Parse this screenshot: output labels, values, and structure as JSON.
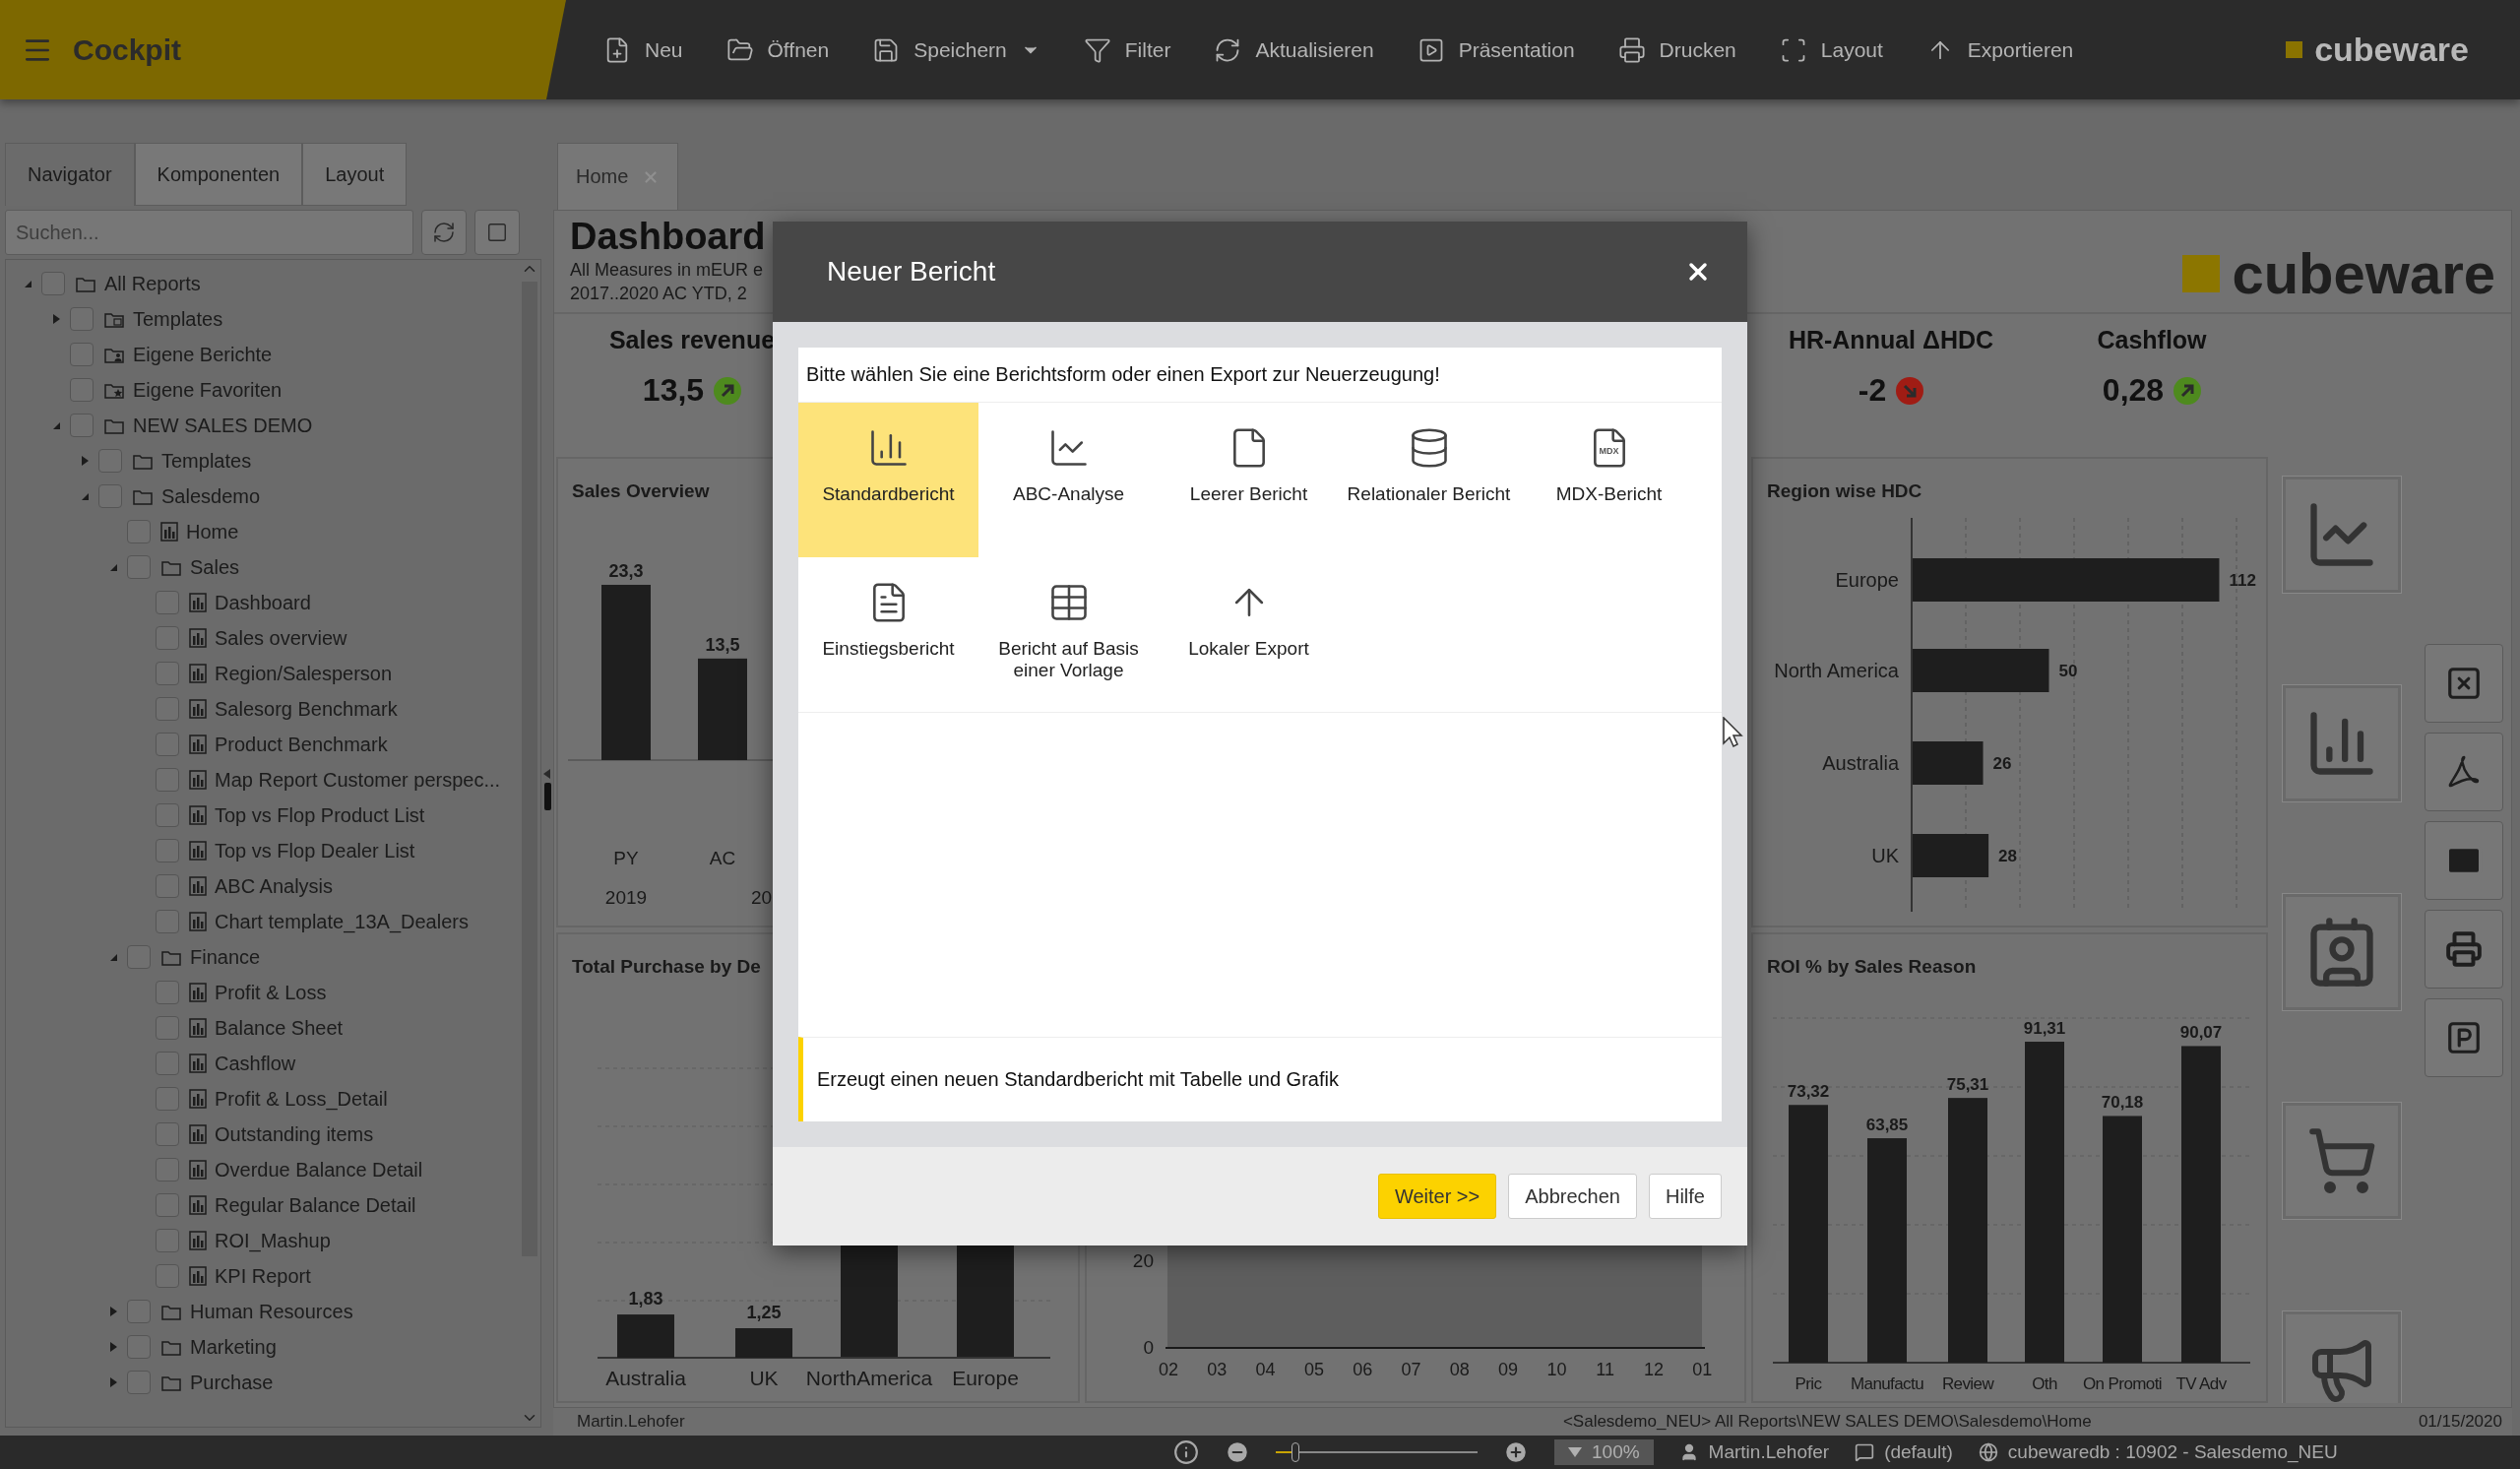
{
  "app": {
    "title": "Cockpit",
    "brand": "cubeware"
  },
  "toolbar": [
    {
      "label": "Neu"
    },
    {
      "label": "Öffnen"
    },
    {
      "label": "Speichern",
      "dropdown": true
    },
    {
      "label": "Filter"
    },
    {
      "label": "Aktualisieren"
    },
    {
      "label": "Präsentation"
    },
    {
      "label": "Drucken"
    },
    {
      "label": "Layout"
    },
    {
      "label": "Exportieren"
    }
  ],
  "sidebar": {
    "tabs": [
      {
        "label": "Navigator",
        "selected": true
      },
      {
        "label": "Komponenten",
        "selected": false
      },
      {
        "label": "Layout",
        "selected": false
      }
    ],
    "search": {
      "placeholder": "Suchen..."
    },
    "tree": [
      {
        "label": "All Reports",
        "kind": "folder",
        "checked": false,
        "expanded": true,
        "children": [
          {
            "label": "Templates",
            "kind": "template-folder",
            "checked": false,
            "expanded": false
          },
          {
            "label": "Eigene Berichte",
            "kind": "user-folder",
            "checked": false
          },
          {
            "label": "Eigene Favoriten",
            "kind": "favorites-folder",
            "checked": false
          },
          {
            "label": "NEW SALES DEMO",
            "kind": "folder",
            "checked": false,
            "expanded": true,
            "children": [
              {
                "label": "Templates",
                "kind": "folder",
                "checked": false,
                "expanded": false
              },
              {
                "label": "Salesdemo",
                "kind": "folder",
                "checked": false,
                "expanded": true,
                "children": [
                  {
                    "label": "Home",
                    "kind": "report",
                    "checked": false
                  },
                  {
                    "label": "Sales",
                    "kind": "folder",
                    "checked": false,
                    "expanded": true,
                    "children": [
                      {
                        "label": "Dashboard",
                        "kind": "report",
                        "checked": false
                      },
                      {
                        "label": "Sales overview",
                        "kind": "report",
                        "checked": false
                      },
                      {
                        "label": "Region/Salesperson",
                        "kind": "report",
                        "checked": false
                      },
                      {
                        "label": "Salesorg Benchmark",
                        "kind": "report",
                        "checked": false
                      },
                      {
                        "label": "Product Benchmark",
                        "kind": "report",
                        "checked": false
                      },
                      {
                        "label": "Map Report Customer perspec...",
                        "kind": "report",
                        "checked": false
                      },
                      {
                        "label": "Top vs Flop Product List",
                        "kind": "report",
                        "checked": false
                      },
                      {
                        "label": "Top vs Flop Dealer List",
                        "kind": "report",
                        "checked": false
                      },
                      {
                        "label": "ABC Analysis",
                        "kind": "report",
                        "checked": false
                      },
                      {
                        "label": "Chart template_13A_Dealers",
                        "kind": "report",
                        "checked": false
                      }
                    ]
                  },
                  {
                    "label": "Finance",
                    "kind": "folder",
                    "checked": false,
                    "expanded": true,
                    "children": [
                      {
                        "label": "Profit & Loss",
                        "kind": "report",
                        "checked": false
                      },
                      {
                        "label": "Balance Sheet",
                        "kind": "report",
                        "checked": false
                      },
                      {
                        "label": "Cashflow",
                        "kind": "report",
                        "checked": false
                      },
                      {
                        "label": "Profit & Loss_Detail",
                        "kind": "report",
                        "checked": false
                      },
                      {
                        "label": "Outstanding items",
                        "kind": "report",
                        "checked": false
                      },
                      {
                        "label": "Overdue Balance Detail",
                        "kind": "report",
                        "checked": false
                      },
                      {
                        "label": "Regular Balance Detail",
                        "kind": "report",
                        "checked": false
                      },
                      {
                        "label": "ROI_Mashup",
                        "kind": "report",
                        "checked": false
                      },
                      {
                        "label": "KPI Report",
                        "kind": "report",
                        "checked": false
                      }
                    ]
                  },
                  {
                    "label": "Human Resources",
                    "kind": "folder",
                    "checked": false,
                    "expanded": false
                  },
                  {
                    "label": "Marketing",
                    "kind": "folder",
                    "checked": false,
                    "expanded": false
                  },
                  {
                    "label": "Purchase",
                    "kind": "folder",
                    "checked": false,
                    "expanded": false
                  }
                ]
              }
            ]
          }
        ]
      }
    ]
  },
  "document_tabs": [
    {
      "label": "Home",
      "selected": true
    }
  ],
  "dashboard": {
    "title": "Dashboard",
    "subtitle_lines": [
      "All Measures in mEUR e",
      "2017..2020 AC YTD, 2"
    ],
    "brand": "cubeware",
    "kpis": [
      {
        "title": "Sales revenue",
        "value": "13,5",
        "rising": true
      },
      {
        "title": "HR-Annual ΔHDC",
        "value": "-2",
        "rising": false
      },
      {
        "title": "Cashflow",
        "value": "0,28",
        "rising": true
      }
    ],
    "sales_overview": {
      "title": "Sales Overview",
      "periods": [
        "2019",
        "20"
      ],
      "chart_data": {
        "type": "bar",
        "categories": [
          "PY",
          "AC"
        ],
        "values": [
          23.3,
          13.5
        ],
        "value_labels": [
          "23,3",
          "13,5"
        ]
      }
    },
    "total_purchase": {
      "title": "Total Purchase by De",
      "chart_data": {
        "type": "bar",
        "categories": [
          "Australia",
          "UK",
          "NorthAmerica",
          "Europe"
        ],
        "values": [
          1.83,
          1.25,
          null,
          null
        ],
        "value_labels": [
          "1,83",
          "1,25",
          null,
          null
        ]
      }
    },
    "monthly_chart": {
      "y_labels": [
        "20",
        "0"
      ],
      "x_labels": [
        "02",
        "03",
        "04",
        "05",
        "06",
        "07",
        "08",
        "09",
        "10",
        "11",
        "12",
        "01"
      ]
    },
    "region_hdc": {
      "title": "Region wise HDC",
      "chart_data": {
        "type": "bar",
        "orientation": "horizontal",
        "categories": [
          "Europe",
          "North America",
          "Australia",
          "UK"
        ],
        "values": [
          112,
          50,
          26,
          28
        ],
        "value_labels": [
          "112",
          "50",
          "26",
          "28"
        ]
      }
    },
    "roi": {
      "title": "ROI % by Sales Reason",
      "chart_data": {
        "type": "bar",
        "categories": [
          "Pric",
          "Manufactu",
          "Review",
          "Oth",
          "On Promoti",
          "TV Adv"
        ],
        "values": [
          73.32,
          63.85,
          75.31,
          91.31,
          70.18,
          90.07
        ],
        "value_labels": [
          "73,32",
          "63,85",
          "75,31",
          "91,31",
          "70,18",
          "90,07"
        ]
      }
    }
  },
  "status": {
    "user": "Martin.Lehofer",
    "path": "<Salesdemo_NEU> All Reports\\NEW SALES DEMO\\Salesdemo\\Home",
    "date": "01/15/2020"
  },
  "bottom_bar": {
    "zoom_slider": {
      "level": 0.08
    },
    "zoom": "100%",
    "user": "Martin.Lehofer",
    "layout": "(default)",
    "connection": "cubewaredb : 10902 - Salesdemo_NEU"
  },
  "dialog": {
    "title": "Neuer Bericht",
    "prompt": "Bitte wählen Sie eine Berichtsform oder einen Export zur Neuerzeugung!",
    "options": [
      {
        "label": "Standardbericht",
        "selected": true
      },
      {
        "label": "ABC-Analyse",
        "selected": false
      },
      {
        "label": "Leerer Bericht",
        "selected": false
      },
      {
        "label": "Relationaler Bericht",
        "selected": false
      },
      {
        "label": "MDX-Bericht",
        "selected": false,
        "badge": "MDX"
      },
      {
        "label": "Einstiegsbericht",
        "selected": false
      },
      {
        "label": "Bericht auf Basis einer Vorlage",
        "selected": false
      },
      {
        "label": "Lokaler Export",
        "selected": false
      }
    ],
    "description": "Erzeugt einen neuen Standardbericht mit Tabelle und Grafik",
    "buttons": [
      {
        "label": "Weiter >>",
        "kind": "primary"
      },
      {
        "label": "Abbrechen",
        "kind": "default"
      },
      {
        "label": "Hilfe",
        "kind": "default"
      }
    ]
  }
}
